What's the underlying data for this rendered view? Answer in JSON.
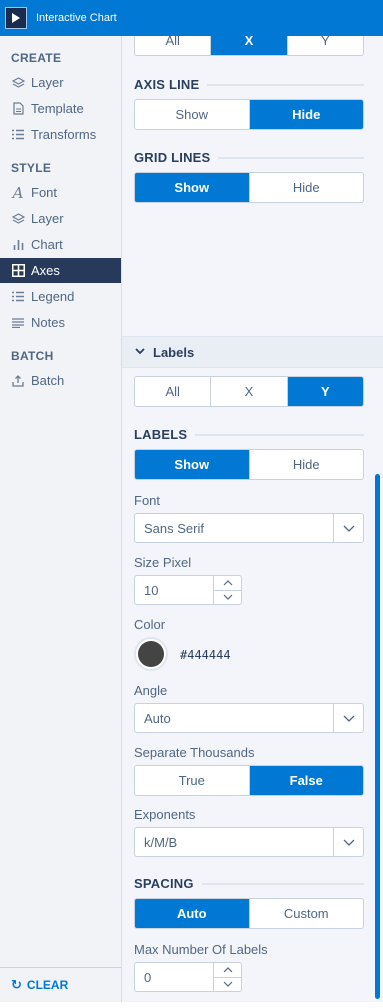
{
  "window": {
    "title": "Interactive Chart"
  },
  "sidebar": {
    "sections": [
      {
        "title": "CREATE",
        "items": [
          {
            "label": "Layer",
            "icon": "layers-icon"
          },
          {
            "label": "Template",
            "icon": "document-icon"
          },
          {
            "label": "Transforms",
            "icon": "list-icon"
          }
        ]
      },
      {
        "title": "STYLE",
        "items": [
          {
            "label": "Font",
            "icon": "font-icon"
          },
          {
            "label": "Layer",
            "icon": "layers-icon"
          },
          {
            "label": "Chart",
            "icon": "bar-chart-icon"
          },
          {
            "label": "Axes",
            "icon": "grid-icon",
            "active": true
          },
          {
            "label": "Legend",
            "icon": "list-icon"
          },
          {
            "label": "Notes",
            "icon": "notes-icon"
          }
        ]
      },
      {
        "title": "BATCH",
        "items": [
          {
            "label": "Batch",
            "icon": "batch-icon"
          }
        ]
      }
    ],
    "clear_label": "CLEAR"
  },
  "panel": {
    "top_axis_selector": {
      "options": [
        "All",
        "X",
        "Y"
      ],
      "selected": "X"
    },
    "axis_line": {
      "heading": "AXIS LINE",
      "options": [
        "Show",
        "Hide"
      ],
      "selected": "Hide"
    },
    "grid_lines": {
      "heading": "GRID LINES",
      "options": [
        "Show",
        "Hide"
      ],
      "selected": "Show"
    },
    "labels_section": {
      "title": "Labels",
      "axis_selector": {
        "options": [
          "All",
          "X",
          "Y"
        ],
        "selected": "Y"
      },
      "labels": {
        "heading": "LABELS",
        "options": [
          "Show",
          "Hide"
        ],
        "selected": "Show"
      },
      "font": {
        "label": "Font",
        "value": "Sans Serif"
      },
      "size": {
        "label": "Size Pixel",
        "value": "10"
      },
      "color": {
        "label": "Color",
        "value": "#444444"
      },
      "angle": {
        "label": "Angle",
        "value": "Auto"
      },
      "separate_thousands": {
        "label": "Separate Thousands",
        "options": [
          "True",
          "False"
        ],
        "selected": "False"
      },
      "exponents": {
        "label": "Exponents",
        "value": "k/M/B"
      },
      "spacing": {
        "heading": "SPACING",
        "options": [
          "Auto",
          "Custom"
        ],
        "selected": "Auto"
      },
      "max_labels": {
        "label": "Max Number Of Labels",
        "value": "0"
      }
    }
  },
  "colors": {
    "accent": "#0078d4",
    "sidebar_active": "#283a5c",
    "panel_bg": "#f3f5fa",
    "label_color": "#444444"
  }
}
